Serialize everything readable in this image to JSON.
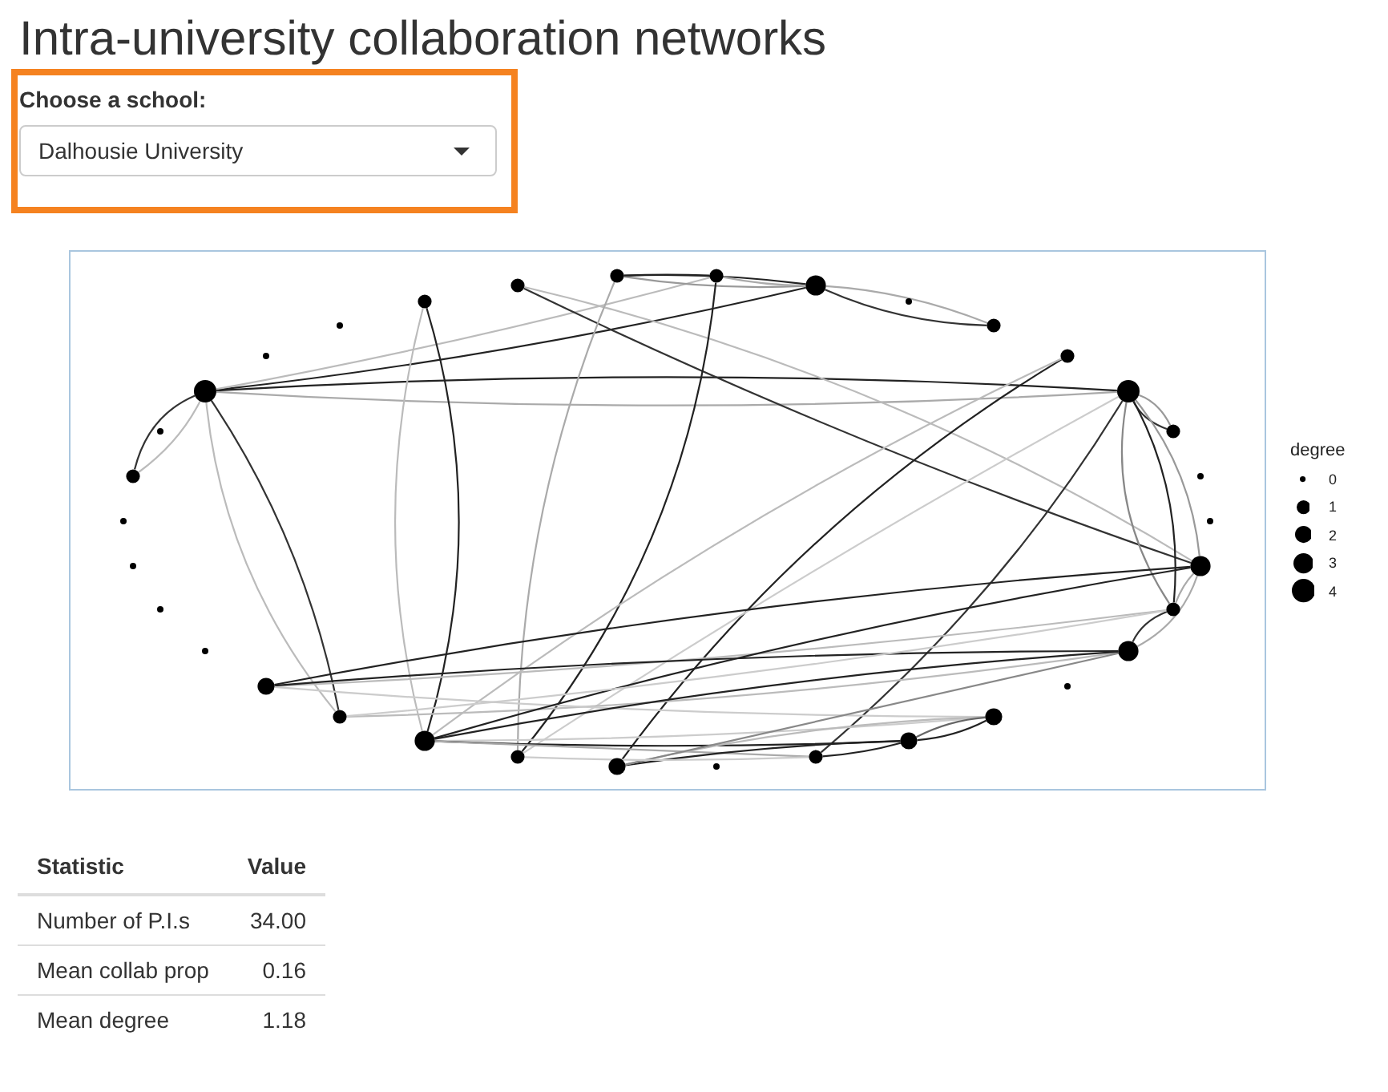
{
  "title": "Intra-university collaboration networks",
  "school_select": {
    "label": "Choose a school:",
    "value": "Dalhousie University",
    "highlighted": true
  },
  "network": {
    "legend": {
      "title": "degree",
      "items": [
        "0",
        "1",
        "2",
        "3",
        "4"
      ]
    }
  },
  "stats_table": {
    "columns": [
      "Statistic",
      "Value"
    ],
    "rows": [
      [
        "Number of P.I.s",
        "34.00"
      ],
      [
        "Mean collab prop",
        "0.16"
      ],
      [
        "Mean degree",
        "1.18"
      ]
    ]
  }
}
